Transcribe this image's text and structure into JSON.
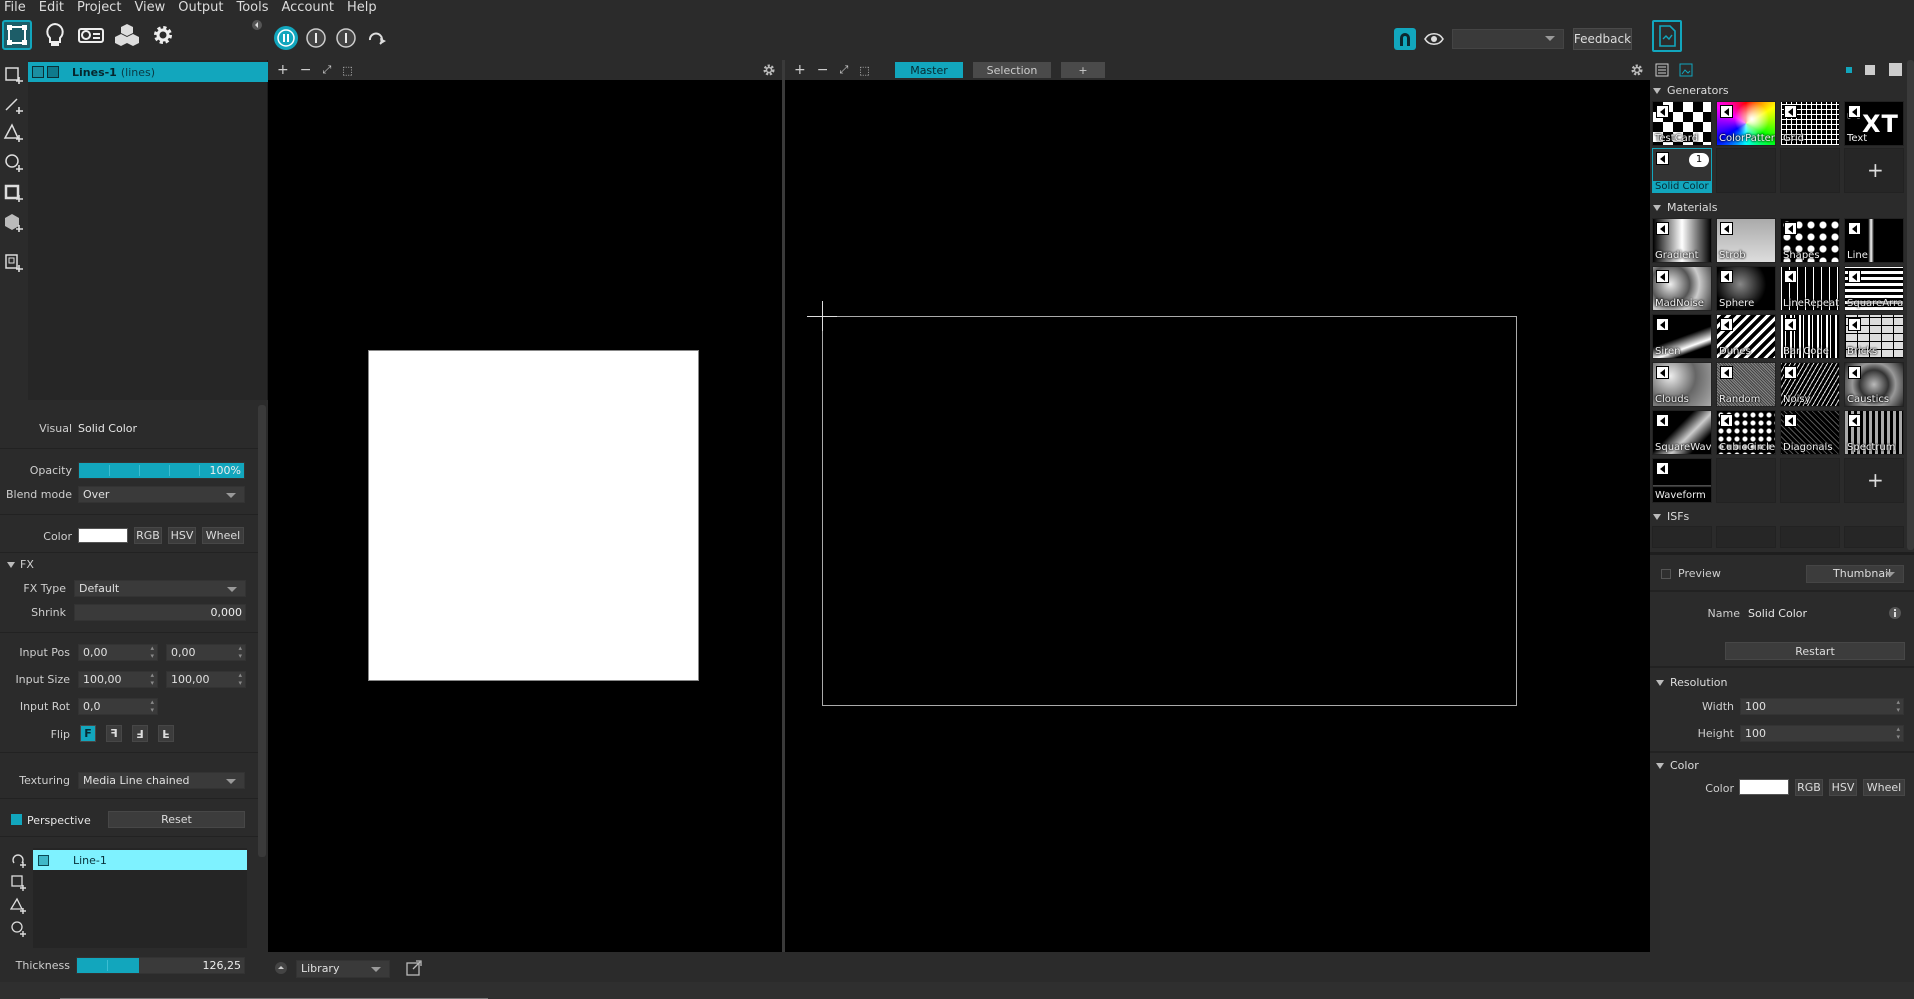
{
  "menu": [
    "File",
    "Edit",
    "Project",
    "View",
    "Output",
    "Tools",
    "Account",
    "Help"
  ],
  "toolbar": {
    "tools": [
      "surface-mode-icon",
      "lightbulb-icon",
      "projector-icon",
      "cubes-icon",
      "gear-icon"
    ],
    "transport": [
      "pause-icon",
      "stop-icon",
      "stop-icon-2",
      "loop-icon"
    ],
    "magnet_active": true,
    "output_select_value": "",
    "feedback_label": "Feedback",
    "accent": "#12a6bd"
  },
  "layers": [
    {
      "name": "Lines-1",
      "type": "(lines)",
      "selected": true
    }
  ],
  "props": {
    "visual_label": "Visual",
    "visual_value": "Solid Color",
    "opacity_label": "Opacity",
    "opacity_value": "100%",
    "opacity_level": 1.0,
    "blend_label": "Blend mode",
    "blend_value": "Over",
    "color_label": "Color",
    "color_hex": "#ffffff",
    "rgb": "RGB",
    "hsv": "HSV",
    "wheel": "Wheel",
    "fx_header": "FX",
    "fx_type_label": "FX Type",
    "fx_type_value": "Default",
    "shrink_label": "Shrink",
    "shrink_value": "0,000",
    "input_pos_label": "Input Pos",
    "input_pos_x": "0,00",
    "input_pos_y": "0,00",
    "input_size_label": "Input Size",
    "input_size_w": "100,00",
    "input_size_h": "100,00",
    "input_rot_label": "Input Rot",
    "input_rot_value": "0,0",
    "flip_label": "Flip",
    "flip_options": [
      "F",
      "F",
      "F",
      "F"
    ],
    "texturing_label": "Texturing",
    "texturing_value": "Media Line chained",
    "perspective_label": "Perspective",
    "reset_label": "Reset",
    "shapes": [
      {
        "name": "Line-1"
      }
    ],
    "thickness_label": "Thickness",
    "thickness_value": "126,25",
    "thickness_level": 0.37
  },
  "viewport_left": {
    "tools": [
      "+",
      "−",
      "⤢",
      "⬚"
    ]
  },
  "viewport_right": {
    "tools": [
      "+",
      "−",
      "⤢",
      "⬚"
    ],
    "tabs": [
      {
        "label": "Master",
        "active": true
      },
      {
        "label": "Selection",
        "active": false
      },
      {
        "label": "+",
        "active": false
      }
    ]
  },
  "library": {
    "select_value": "Library"
  },
  "right": {
    "generators_title": "Generators",
    "generators": [
      "TestCard",
      "ColorPattern",
      "Grid",
      "Text",
      "Solid Color"
    ],
    "text_thumb_glyph": "⃩XT",
    "solid_color_badge": "1",
    "materials_title": "Materials",
    "materials": [
      "Gradient",
      "Strob",
      "Shapes",
      "Line",
      "MadNoise",
      "Sphere",
      "LineRepeat",
      "SquareArray",
      "Siren",
      "Dunes",
      "Bar Code",
      "Bricks",
      "Clouds",
      "Random",
      "Noisy",
      "Caustics",
      "SquareWave",
      "CubicCircles",
      "Diagonals",
      "Spectrum",
      "Waveform"
    ],
    "isfs_title": "ISFs",
    "preview_label": "Preview",
    "thumbnail_select": "Thumbnail",
    "name_label": "Name",
    "name_value": "Solid Color",
    "restart_label": "Restart",
    "resolution_title": "Resolution",
    "width_label": "Width",
    "width_value": "100",
    "height_label": "Height",
    "height_value": "100",
    "color_title": "Color",
    "color_label": "Color",
    "rgb": "RGB",
    "hsv": "HSV",
    "wheel": "Wheel"
  }
}
